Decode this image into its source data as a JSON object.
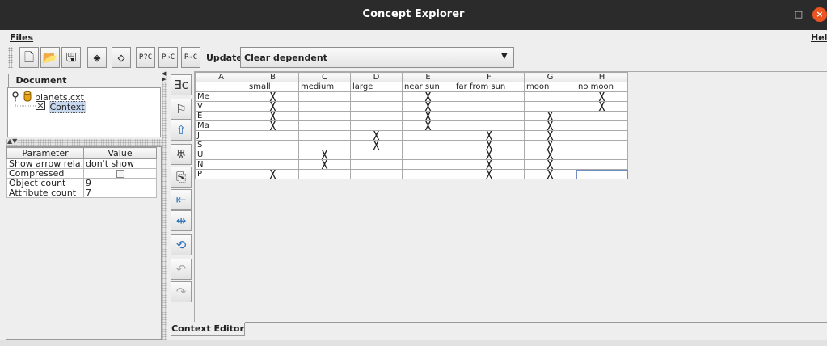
{
  "window": {
    "title": "Concept Explorer"
  },
  "menu": {
    "files": "Files",
    "help": "Help"
  },
  "toolbar": {
    "buttons": [
      {
        "name": "new-document-button",
        "glyph": "🗋",
        "icon": "new-file-icon"
      },
      {
        "name": "open-button",
        "glyph": "📂",
        "icon": "folder-open-icon"
      },
      {
        "name": "save-button",
        "glyph": "🖫",
        "icon": "save-icon"
      },
      {
        "name": "lattice-button",
        "glyph": "◈",
        "icon": "lattice-icon"
      },
      {
        "name": "lattice-small-button",
        "glyph": "◇",
        "icon": "lattice-small-icon"
      },
      {
        "name": "p-query-c-button",
        "glyph": "P?C",
        "icon": ""
      },
      {
        "name": "p-to-c-button",
        "glyph": "P→C",
        "icon": ""
      },
      {
        "name": "p-fuzzy-c-button",
        "glyph": "P⇝C",
        "icon": ""
      }
    ],
    "update_label": "Update:",
    "update_value": "Clear dependent"
  },
  "document": {
    "tab_label": "Document",
    "tree_file": "planets.cxt",
    "tree_context": "Context"
  },
  "params": {
    "headers": [
      "Parameter",
      "Value"
    ],
    "rows": [
      {
        "name": "Show arrow rela...",
        "value": "don't show"
      },
      {
        "name": "Compressed",
        "value": ""
      },
      {
        "name": "Object count",
        "value": "9"
      },
      {
        "name": "Attribute count",
        "value": "7"
      }
    ]
  },
  "context": {
    "column_letters": [
      "A",
      "B",
      "C",
      "D",
      "E",
      "F",
      "G",
      "H"
    ],
    "attributes": [
      "",
      "small",
      "medium",
      "large",
      "near sun",
      "far from sun",
      "moon",
      "no moon"
    ],
    "objects": [
      {
        "name": "Me",
        "marks": [
          1,
          0,
          0,
          1,
          0,
          0,
          1
        ]
      },
      {
        "name": "V",
        "marks": [
          1,
          0,
          0,
          1,
          0,
          0,
          1
        ]
      },
      {
        "name": "E",
        "marks": [
          1,
          0,
          0,
          1,
          0,
          1,
          0
        ]
      },
      {
        "name": "Ma",
        "marks": [
          1,
          0,
          0,
          1,
          0,
          1,
          0
        ]
      },
      {
        "name": "J",
        "marks": [
          0,
          0,
          1,
          0,
          1,
          1,
          0
        ]
      },
      {
        "name": "S",
        "marks": [
          0,
          0,
          1,
          0,
          1,
          1,
          0
        ]
      },
      {
        "name": "U",
        "marks": [
          0,
          1,
          0,
          0,
          1,
          1,
          0
        ]
      },
      {
        "name": "N",
        "marks": [
          0,
          1,
          0,
          0,
          1,
          1,
          0
        ]
      },
      {
        "name": "P",
        "marks": [
          1,
          0,
          0,
          0,
          1,
          1,
          0
        ]
      }
    ],
    "cross_glyph": "╳"
  },
  "bottom_tab": "Context Editor"
}
